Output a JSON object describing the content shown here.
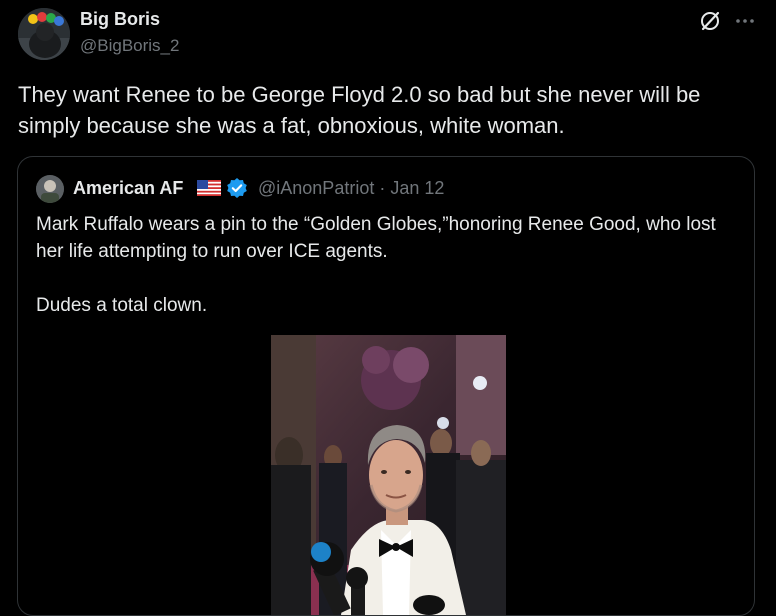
{
  "post": {
    "author": {
      "name": "Big Boris",
      "handle": "@BigBoris_2"
    },
    "text": "They want Renee to be George Floyd 2.0 so bad but she never will be simply because she was a fat, obnoxious, white woman."
  },
  "quote": {
    "author": {
      "name": "American AF",
      "handle": "@iAnonPatriot",
      "separator": "·",
      "date": "Jan 12"
    },
    "paragraphs": [
      "Mark Ruffalo wears a pin to the “Golden Globes,”honoring Renee Good, who lost her life attempting to run over ICE agents.",
      "Dudes a total clown."
    ]
  },
  "icons": {
    "grok": "grok-icon",
    "more": "more-dots-icon",
    "flag": "us-flag-icon",
    "verified": "verified-badge-icon"
  },
  "colors": {
    "background": "#000000",
    "text": "#e7e9ea",
    "secondary": "#71767b",
    "border": "#2f3336",
    "verified": "#1d9bf0"
  }
}
